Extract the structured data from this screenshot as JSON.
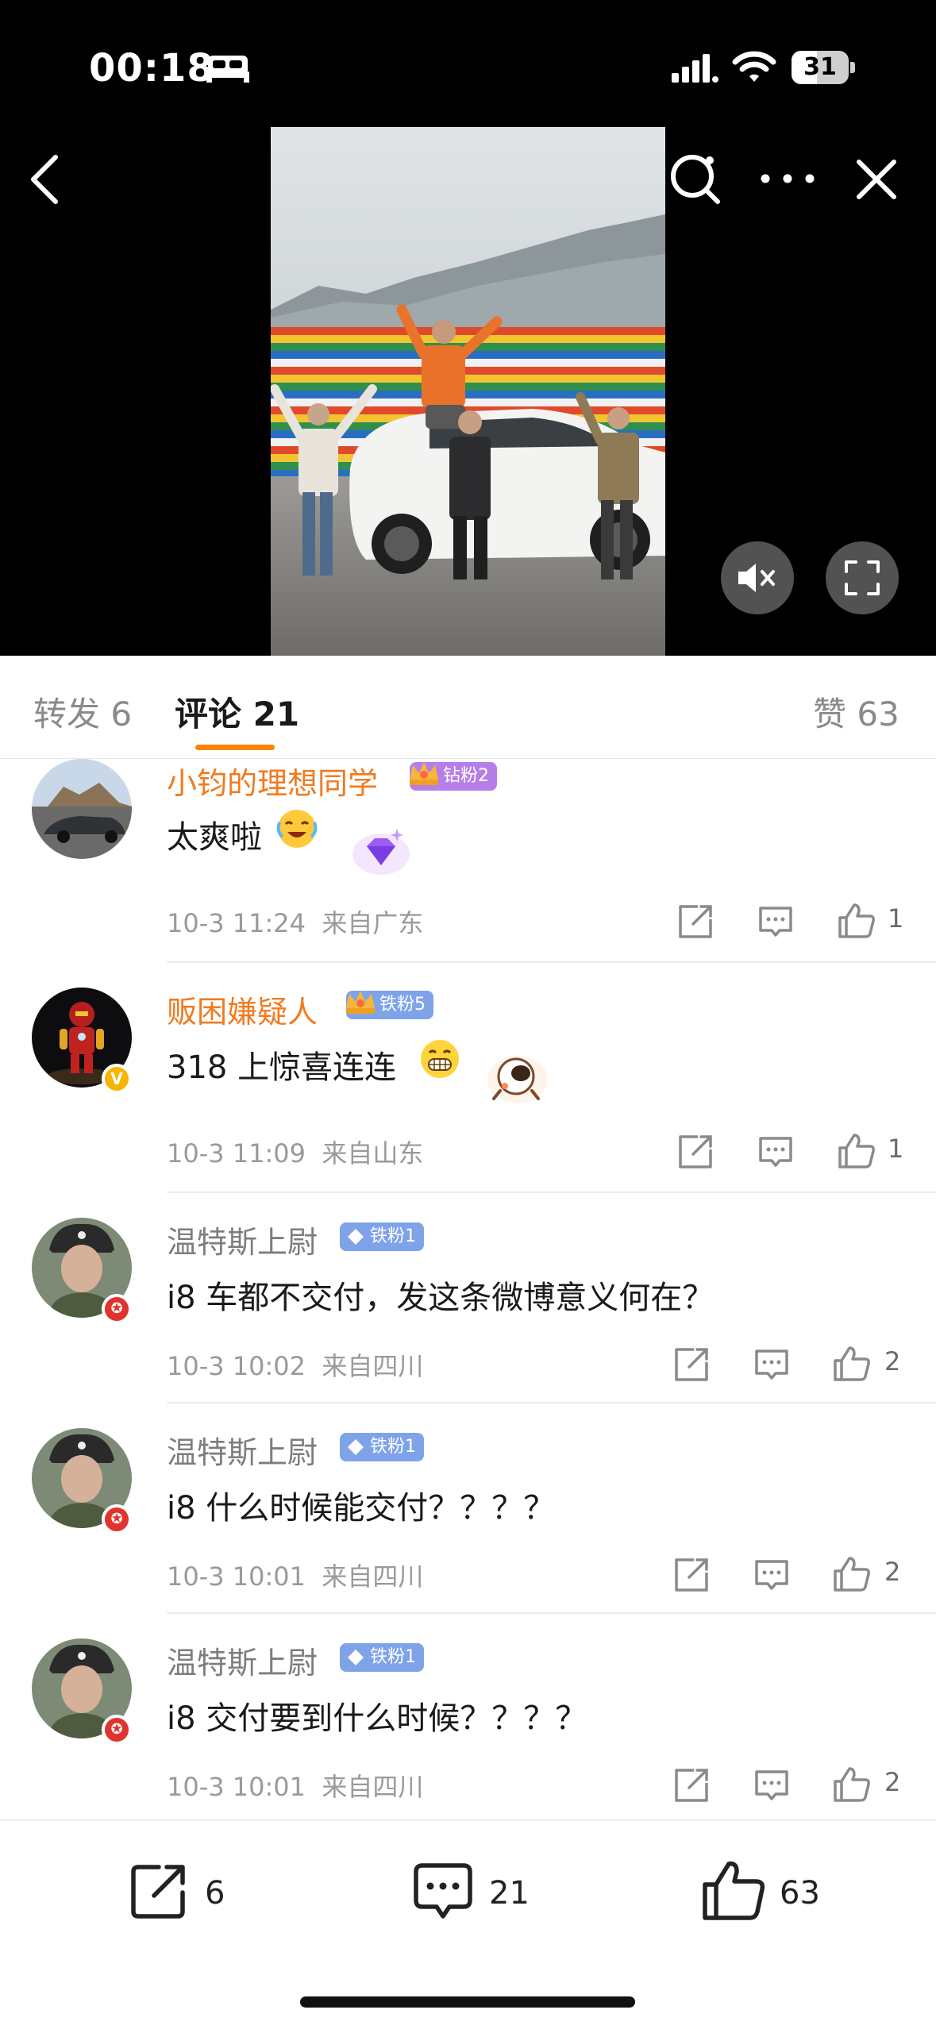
{
  "status_bar": {
    "time": "00:18",
    "battery": "31"
  },
  "nav": {
    "icons": [
      "back-icon",
      "search-icon",
      "more-icon",
      "close-icon"
    ]
  },
  "video": {
    "controls": [
      "mute-icon",
      "fullscreen-icon"
    ]
  },
  "tabs": {
    "repost_label": "转发 6",
    "comments_label": "评论 21",
    "likes_label": "赞 63"
  },
  "comments": [
    {
      "name": "小钧的理想同学",
      "fan_badge": "钻粉2",
      "text": "太爽啦",
      "time": "10-3 11:24",
      "location": "来自广东",
      "likes": "1"
    },
    {
      "name": "贩困嫌疑人",
      "fan_badge": "铁粉5",
      "text": "318 上惊喜连连",
      "time": "10-3 11:09",
      "location": "来自山东",
      "likes": "1"
    },
    {
      "name": "温特斯上尉",
      "fan_badge": "铁粉1",
      "text": "i8 车都不交付，发这条微博意义何在？",
      "time": "10-3 10:02",
      "location": "来自四川",
      "likes": "2"
    },
    {
      "name": "温特斯上尉",
      "fan_badge": "铁粉1",
      "text": "i8 什么时候能交付？？？？",
      "time": "10-3 10:01",
      "location": "来自四川",
      "likes": "2"
    },
    {
      "name": "温特斯上尉",
      "fan_badge": "铁粉1",
      "text": "i8 交付要到什么时候？？？？",
      "time": "10-3 10:01",
      "location": "来自四川",
      "likes": "2"
    }
  ],
  "bottom_bar": {
    "repost_count": "6",
    "comment_count": "21",
    "like_count": "63"
  },
  "colors": {
    "accent": "#ff8200",
    "orange_name": "#f07b20",
    "fan_badge_blue": "#7fa3e9",
    "fan_badge_purple": "#b67fe8"
  }
}
